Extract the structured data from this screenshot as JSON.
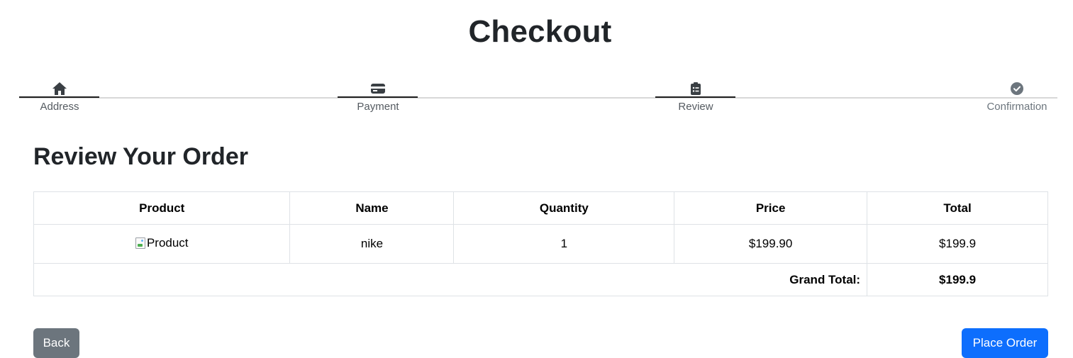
{
  "page": {
    "title": "Checkout"
  },
  "stepper": {
    "steps": [
      {
        "label": "Address",
        "icon": "home-icon",
        "completed": true
      },
      {
        "label": "Payment",
        "icon": "credit-card-icon",
        "completed": true
      },
      {
        "label": "Review",
        "icon": "clipboard-list-icon",
        "completed": true
      },
      {
        "label": "Confirmation",
        "icon": "check-circle-icon",
        "completed": false
      }
    ]
  },
  "review": {
    "heading": "Review Your Order",
    "table": {
      "headers": [
        "Product",
        "Name",
        "Quantity",
        "Price",
        "Total"
      ],
      "rows": [
        {
          "product_alt": "Product",
          "name": "nike",
          "quantity": "1",
          "price": "$199.90",
          "total": "$199.9"
        }
      ],
      "grand_total_label": "Grand Total:",
      "grand_total_value": "$199.9"
    }
  },
  "actions": {
    "back_label": "Back",
    "place_order_label": "Place Order"
  },
  "colors": {
    "primary": "#0d6efd",
    "secondary": "#6c757d",
    "step_bar": "#1f1f1f",
    "step_track": "#d8d8d8"
  }
}
